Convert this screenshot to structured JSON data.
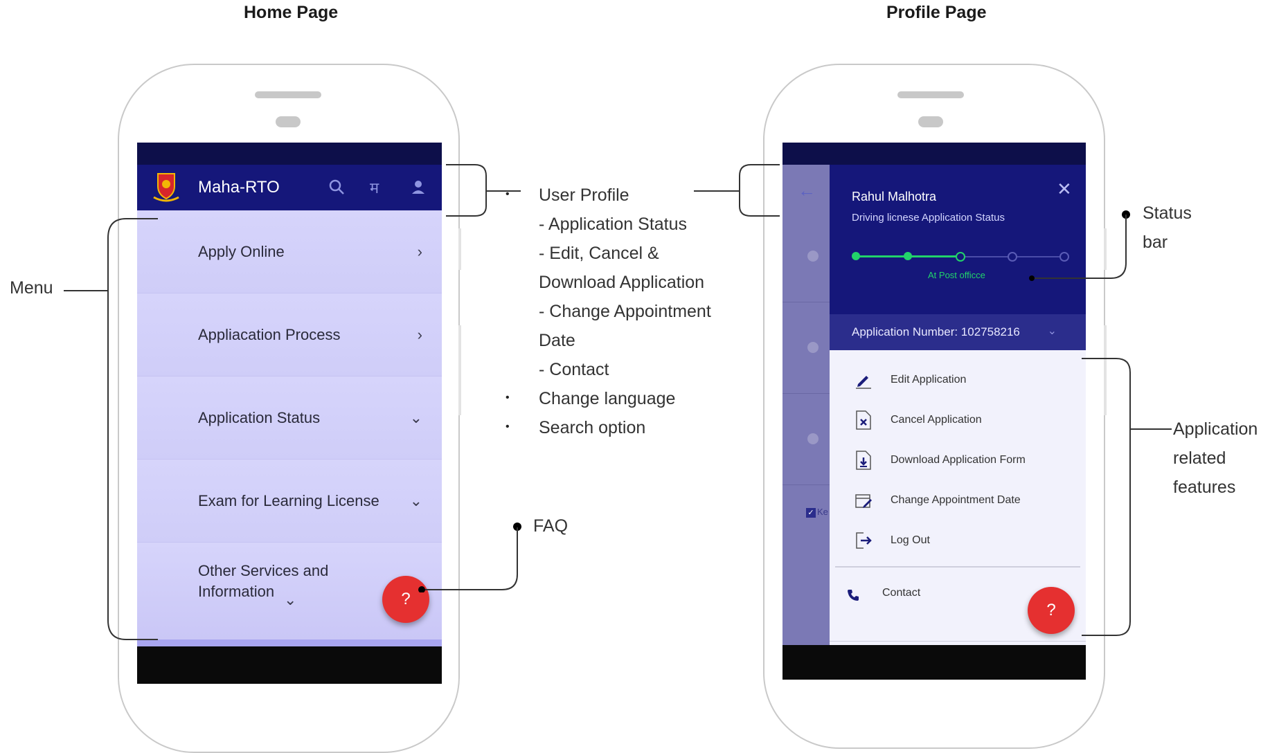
{
  "titles": {
    "home": "Home Page",
    "profile": "Profile Page"
  },
  "home": {
    "app_name": "Maha-RTO",
    "lang_glyph": "म",
    "menu": [
      {
        "label": "Apply Online",
        "chev": "›"
      },
      {
        "label": "Appliacation Process",
        "chev": "›"
      },
      {
        "label": "Application Status",
        "chev": "⌄"
      },
      {
        "label": "Exam for Learning License",
        "chev": "⌄"
      }
    ],
    "other_line1": "Other Services and",
    "other_line2": "Information",
    "other_chev": "⌄",
    "faq_glyph": "?"
  },
  "annotations": {
    "menu": "Menu",
    "faq": "FAQ",
    "bullet": "•",
    "user_profile": "User Profile",
    "lines": [
      "- Application Status",
      "- Edit, Cancel &",
      "Download Application",
      "- Change Appointment",
      "Date",
      "- Contact"
    ],
    "change_language": "Change language",
    "search_option": "Search option",
    "status_bar_1": "Status",
    "status_bar_2": "bar",
    "features_1": "Application",
    "features_2": "related",
    "features_3": "features"
  },
  "profile": {
    "back_glyph": "←",
    "close_glyph": "✕",
    "user_name": "Rahul Malhotra",
    "subtitle": "Driving licnese Application Status",
    "progress": {
      "steps_total": 5,
      "steps_done": 3
    },
    "stage_label": "At Post officce",
    "app_number": "Application Number: 102758216",
    "features": [
      {
        "label": "Edit Application",
        "icon": "pencil-icon"
      },
      {
        "label": "Cancel Application",
        "icon": "cancel-document-icon"
      },
      {
        "label": "Download Application Form",
        "icon": "download-document-icon"
      },
      {
        "label": "Change Appointment Date",
        "icon": "calendar-edit-icon"
      },
      {
        "label": "Log Out",
        "icon": "logout-icon"
      }
    ],
    "contact": "Contact",
    "faq_glyph": "?",
    "behind_text": "Ke"
  },
  "colors": {
    "header": "#15177a",
    "menu_bg": "#d2d0f9",
    "fab": "#e53030",
    "progress_green": "#22d36a"
  }
}
